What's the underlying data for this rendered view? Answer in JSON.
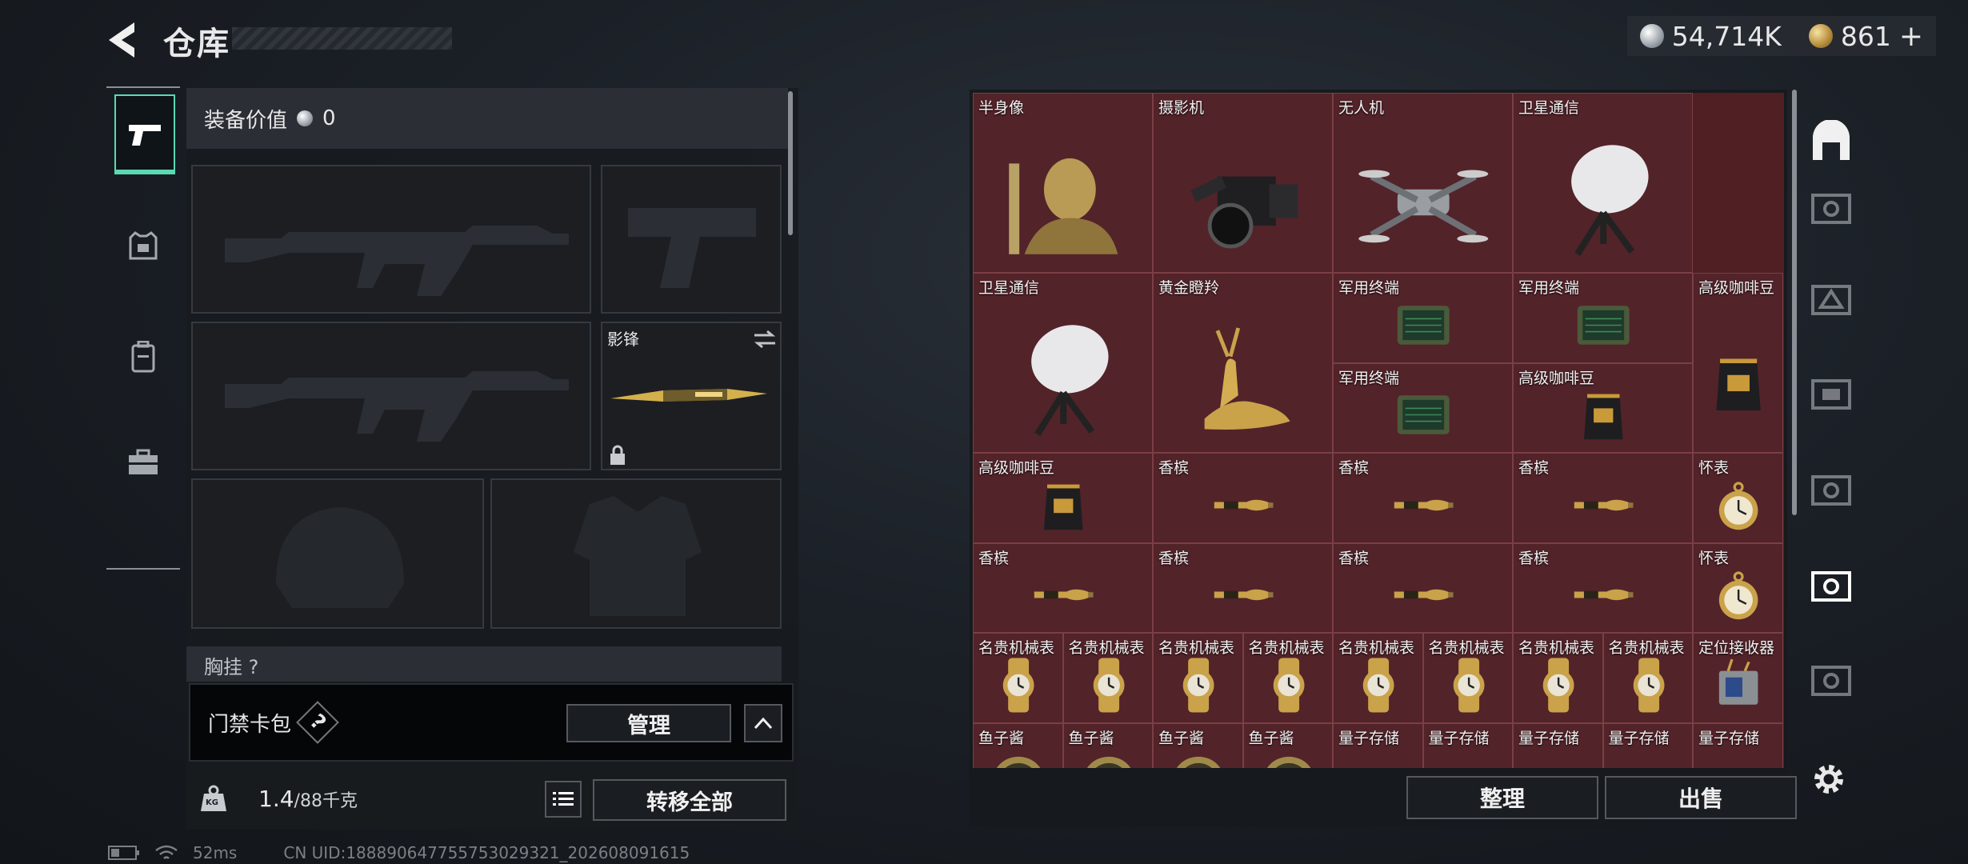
{
  "header": {
    "title": "仓库"
  },
  "currency": {
    "silver": "54,714K",
    "gold": "861",
    "gold_suffix": "+"
  },
  "equipment": {
    "value_label": "装备价值",
    "value": "0",
    "knife_name": "影锋",
    "chest_label": "胸挂",
    "chest_suffix": "?"
  },
  "keypack": {
    "label": "门禁卡包",
    "help": "?",
    "manage": "管理"
  },
  "weight": {
    "current": "1.4",
    "max_unit": "/88千克",
    "kg": "KG",
    "transfer_all": "转移全部"
  },
  "status": {
    "ping": "52ms",
    "uid": "CN UID:18889064775575302932​1_202608091615"
  },
  "storage": {
    "sort_button": "整理",
    "sell_button": "出售",
    "items": [
      {
        "label": "半身像",
        "icon": "bust"
      },
      {
        "label": "摄影机",
        "icon": "camera"
      },
      {
        "label": "无人机",
        "icon": "drone"
      },
      {
        "label": "卫星通信",
        "icon": "satellite-dish"
      },
      {
        "label": "卫星通信",
        "icon": "satellite-dish"
      },
      {
        "label": "黄金瞪羚",
        "icon": "golden-gazelle"
      },
      {
        "label": "军用终端",
        "icon": "terminal"
      },
      {
        "label": "军用终端",
        "icon": "terminal"
      },
      {
        "label": "高级咖啡豆",
        "icon": "coffee-bag"
      },
      {
        "label": "军用终端",
        "icon": "terminal"
      },
      {
        "label": "高级咖啡豆",
        "icon": "coffee-bag"
      },
      {
        "label": "高级咖啡豆",
        "icon": "coffee-bag"
      },
      {
        "label": "香槟",
        "icon": "champagne"
      },
      {
        "label": "香槟",
        "icon": "champagne"
      },
      {
        "label": "香槟",
        "icon": "champagne"
      },
      {
        "label": "怀表",
        "icon": "pocket-watch"
      },
      {
        "label": "香槟",
        "icon": "champagne"
      },
      {
        "label": "香槟",
        "icon": "champagne"
      },
      {
        "label": "香槟",
        "icon": "champagne"
      },
      {
        "label": "香槟",
        "icon": "champagne"
      },
      {
        "label": "怀表",
        "icon": "pocket-watch"
      },
      {
        "label": "名贵机械表",
        "icon": "wristwatch"
      },
      {
        "label": "名贵机械表",
        "icon": "wristwatch"
      },
      {
        "label": "名贵机械表",
        "icon": "wristwatch"
      },
      {
        "label": "名贵机械表",
        "icon": "wristwatch"
      },
      {
        "label": "名贵机械表",
        "icon": "wristwatch"
      },
      {
        "label": "名贵机械表",
        "icon": "wristwatch"
      },
      {
        "label": "名贵机械表",
        "icon": "wristwatch"
      },
      {
        "label": "名贵机械表",
        "icon": "wristwatch"
      },
      {
        "label": "定位接收器",
        "icon": "gps-receiver"
      },
      {
        "label": "鱼子酱",
        "icon": "caviar-tin"
      },
      {
        "label": "鱼子酱",
        "icon": "caviar-tin"
      },
      {
        "label": "鱼子酱",
        "icon": "caviar-tin"
      },
      {
        "label": "鱼子酱",
        "icon": "caviar-tin"
      },
      {
        "label": "量子存储",
        "icon": "quantum-storage"
      },
      {
        "label": "量子存储",
        "icon": "quantum-storage"
      },
      {
        "label": "量子存储",
        "icon": "quantum-storage"
      },
      {
        "label": "量子存储",
        "icon": "quantum-storage"
      },
      {
        "label": "量子存储",
        "icon": "quantum-storage"
      }
    ]
  },
  "colors": {
    "accent": "#5bd9b4",
    "storage_bg": "#53232a",
    "gold": "#c9a24a"
  }
}
